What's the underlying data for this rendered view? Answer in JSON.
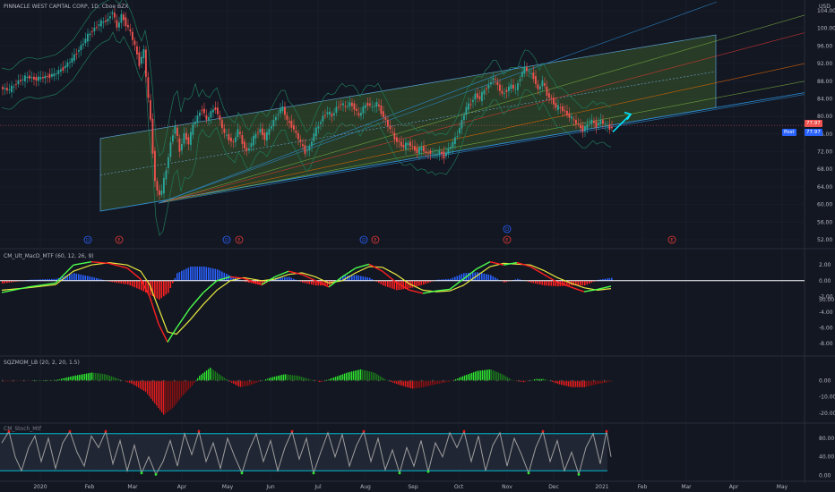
{
  "header": {
    "symbol_title": "PINNACLE WEST CAPITAL CORP, 1D, Cboe BZX",
    "currency": "USD",
    "price_tag": "77.97",
    "post_label": "Post",
    "post_tag": "77.97"
  },
  "colors": {
    "background": "#131722",
    "up_candle": "#26a69a",
    "down_candle": "#ef5350",
    "channel_fill": "#3b5a2a",
    "channel_line": "#2d8fd6",
    "macd_fast": "#4cff4c",
    "macd_slow": "#e8e840",
    "hist_pos": "#2962ff",
    "hist_neg": "#ff2020",
    "sqz_pos": "#2ee62e",
    "sqz_neg": "#e41c1c",
    "stoch_line": "#9e9e9e",
    "stoch_band": "#00bcd4",
    "arrow": "#00e5ff"
  },
  "panes": {
    "macd": {
      "title": "CM_Ult_MacD_MTF (60, 12, 26, 9)",
      "ticks": [
        "2.00",
        "0.00",
        "-2.00",
        "-4.00",
        "-6.00",
        "-8.00"
      ]
    },
    "sqz": {
      "title": "SQZMOM_LB (20, 2, 20, 1.5)",
      "ticks": [
        "50.00",
        "0.00",
        "-10.00",
        "-20.00"
      ]
    },
    "stoch": {
      "title": "CM_Stoch_Mtf",
      "ticks": [
        "80.00",
        "40.00",
        "0.00"
      ]
    }
  },
  "events": [
    {
      "label": "D",
      "type": "dividend"
    },
    {
      "label": "E",
      "type": "earnings"
    },
    {
      "label": "D",
      "type": "dividend"
    },
    {
      "label": "E",
      "type": "earnings"
    },
    {
      "label": "D",
      "type": "dividend"
    },
    {
      "label": "E",
      "type": "earnings"
    },
    {
      "label": "D",
      "type": "dividend"
    },
    {
      "label": "E",
      "type": "earnings"
    },
    {
      "label": "E",
      "type": "earnings"
    }
  ],
  "chart_data": {
    "type": "candlestick",
    "ylim": [
      50,
      106
    ],
    "y_ticks": [
      "104.00",
      "100.00",
      "96.00",
      "92.00",
      "88.00",
      "84.00",
      "80.00",
      "76.00",
      "72.00",
      "68.00",
      "64.00",
      "60.00",
      "56.00",
      "52.00"
    ],
    "x_ticks": [
      "2020",
      "Feb",
      "Mar",
      "Apr",
      "May",
      "Jun",
      "Jul",
      "Aug",
      "Sep",
      "Oct",
      "Nov",
      "Dec",
      "2021",
      "Feb",
      "Mar",
      "Apr",
      "May"
    ],
    "price_path": [
      [
        0,
        86.5
      ],
      [
        10,
        86
      ],
      [
        20,
        88
      ],
      [
        30,
        89
      ],
      [
        40,
        88.5
      ],
      [
        50,
        89
      ],
      [
        60,
        89.5
      ],
      [
        70,
        91
      ],
      [
        80,
        93
      ],
      [
        90,
        96
      ],
      [
        100,
        99
      ],
      [
        110,
        101
      ],
      [
        120,
        102
      ],
      [
        125,
        104
      ],
      [
        130,
        100
      ],
      [
        135,
        103
      ],
      [
        140,
        101
      ],
      [
        145,
        99
      ],
      [
        150,
        96
      ],
      [
        155,
        92
      ],
      [
        160,
        95
      ],
      [
        163,
        88
      ],
      [
        168,
        78
      ],
      [
        172,
        66
      ],
      [
        176,
        62
      ],
      [
        180,
        63
      ],
      [
        185,
        68
      ],
      [
        190,
        74
      ],
      [
        195,
        78
      ],
      [
        200,
        72
      ],
      [
        205,
        76
      ],
      [
        210,
        74
      ],
      [
        215,
        78
      ],
      [
        220,
        80
      ],
      [
        225,
        82
      ],
      [
        230,
        79
      ],
      [
        235,
        81
      ],
      [
        240,
        82
      ],
      [
        245,
        79
      ],
      [
        250,
        76
      ],
      [
        255,
        75
      ],
      [
        260,
        74
      ],
      [
        265,
        77
      ],
      [
        270,
        74
      ],
      [
        275,
        72
      ],
      [
        280,
        74
      ],
      [
        285,
        76
      ],
      [
        290,
        77
      ],
      [
        295,
        75
      ],
      [
        300,
        77
      ],
      [
        305,
        79
      ],
      [
        310,
        81
      ],
      [
        315,
        82
      ],
      [
        320,
        79
      ],
      [
        325,
        78
      ],
      [
        330,
        76
      ],
      [
        335,
        74
      ],
      [
        340,
        72
      ],
      [
        345,
        73
      ],
      [
        350,
        76
      ],
      [
        355,
        78
      ],
      [
        360,
        80
      ],
      [
        365,
        81
      ],
      [
        370,
        80
      ],
      [
        375,
        82
      ],
      [
        380,
        83
      ],
      [
        385,
        82
      ],
      [
        390,
        83
      ],
      [
        395,
        82
      ],
      [
        400,
        80
      ],
      [
        405,
        82
      ],
      [
        410,
        83
      ],
      [
        415,
        82
      ],
      [
        420,
        83
      ],
      [
        425,
        81
      ],
      [
        430,
        79
      ],
      [
        435,
        77
      ],
      [
        440,
        75
      ],
      [
        445,
        74
      ],
      [
        450,
        73
      ],
      [
        455,
        74
      ],
      [
        460,
        73
      ],
      [
        465,
        72
      ],
      [
        470,
        73
      ],
      [
        475,
        71.5
      ],
      [
        480,
        72
      ],
      [
        485,
        71
      ],
      [
        490,
        72
      ],
      [
        495,
        71
      ],
      [
        500,
        72.5
      ],
      [
        505,
        74
      ],
      [
        510,
        76
      ],
      [
        515,
        79
      ],
      [
        520,
        82
      ],
      [
        525,
        83
      ],
      [
        530,
        85
      ],
      [
        535,
        84
      ],
      [
        540,
        86
      ],
      [
        545,
        87
      ],
      [
        550,
        89
      ],
      [
        555,
        87
      ],
      [
        560,
        85
      ],
      [
        565,
        86
      ],
      [
        570,
        87
      ],
      [
        575,
        86
      ],
      [
        580,
        89
      ],
      [
        585,
        91
      ],
      [
        590,
        90
      ],
      [
        595,
        89
      ],
      [
        600,
        86
      ],
      [
        605,
        88
      ],
      [
        610,
        85
      ],
      [
        615,
        84
      ],
      [
        620,
        82
      ],
      [
        625,
        82
      ],
      [
        630,
        81
      ],
      [
        635,
        80
      ],
      [
        640,
        79
      ],
      [
        645,
        78
      ],
      [
        650,
        77
      ],
      [
        655,
        78
      ],
      [
        660,
        79
      ],
      [
        665,
        78
      ],
      [
        670,
        79
      ],
      [
        675,
        78
      ],
      [
        680,
        77.5
      ]
    ],
    "channel": {
      "lower": [
        [
          110,
          58.5
        ],
        [
          797,
          82
        ]
      ],
      "upper": [
        [
          110,
          75
        ],
        [
          797,
          98.5
        ]
      ],
      "mid": [
        [
          110,
          66.7
        ],
        [
          797,
          90.2
        ]
      ]
    },
    "arrow": {
      "from": [
        682,
        76.5
      ],
      "to": [
        702,
        80.5
      ]
    },
    "macd": {
      "ylim": [
        -9,
        3.5
      ],
      "fast": [
        [
          0,
          -1.5
        ],
        [
          30,
          -0.8
        ],
        [
          60,
          -0.3
        ],
        [
          80,
          2
        ],
        [
          100,
          2.4
        ],
        [
          120,
          2.2
        ],
        [
          140,
          1.6
        ],
        [
          155,
          0.2
        ],
        [
          165,
          -2
        ],
        [
          175,
          -5.5
        ],
        [
          185,
          -7.8
        ],
        [
          195,
          -6
        ],
        [
          210,
          -3.5
        ],
        [
          225,
          -1.5
        ],
        [
          240,
          0
        ],
        [
          255,
          0.5
        ],
        [
          270,
          0.3
        ],
        [
          290,
          -0.5
        ],
        [
          305,
          0.5
        ],
        [
          320,
          1.2
        ],
        [
          335,
          0.8
        ],
        [
          350,
          0
        ],
        [
          365,
          -0.8
        ],
        [
          380,
          0.5
        ],
        [
          395,
          1.6
        ],
        [
          410,
          2.1
        ],
        [
          425,
          1.2
        ],
        [
          440,
          -0.2
        ],
        [
          455,
          -1.2
        ],
        [
          470,
          -1.6
        ],
        [
          485,
          -1.3
        ],
        [
          500,
          -1.1
        ],
        [
          515,
          0.2
        ],
        [
          530,
          1.5
        ],
        [
          545,
          2.4
        ],
        [
          560,
          2.0
        ],
        [
          575,
          2.3
        ],
        [
          590,
          1.8
        ],
        [
          605,
          0.8
        ],
        [
          620,
          -0.2
        ],
        [
          635,
          -0.8
        ],
        [
          650,
          -1.4
        ],
        [
          665,
          -1.1
        ],
        [
          680,
          -0.7
        ]
      ],
      "slow": [
        [
          0,
          -1.2
        ],
        [
          30,
          -0.9
        ],
        [
          60,
          -0.5
        ],
        [
          80,
          1.2
        ],
        [
          100,
          2.0
        ],
        [
          120,
          2.3
        ],
        [
          140,
          2.0
        ],
        [
          155,
          1.2
        ],
        [
          165,
          -0.5
        ],
        [
          175,
          -3.5
        ],
        [
          185,
          -6.5
        ],
        [
          195,
          -6.8
        ],
        [
          210,
          -5
        ],
        [
          225,
          -3
        ],
        [
          240,
          -1.2
        ],
        [
          255,
          0
        ],
        [
          270,
          0.4
        ],
        [
          290,
          0
        ],
        [
          305,
          0.2
        ],
        [
          320,
          0.8
        ],
        [
          335,
          1
        ],
        [
          350,
          0.5
        ],
        [
          365,
          -0.3
        ],
        [
          380,
          0
        ],
        [
          395,
          1
        ],
        [
          410,
          1.8
        ],
        [
          425,
          1.7
        ],
        [
          440,
          0.8
        ],
        [
          455,
          -0.4
        ],
        [
          470,
          -1.2
        ],
        [
          485,
          -1.4
        ],
        [
          500,
          -1.3
        ],
        [
          515,
          -0.6
        ],
        [
          530,
          0.6
        ],
        [
          545,
          1.8
        ],
        [
          560,
          2.2
        ],
        [
          575,
          2.1
        ],
        [
          590,
          2.0
        ],
        [
          605,
          1.3
        ],
        [
          620,
          0.4
        ],
        [
          635,
          -0.3
        ],
        [
          650,
          -0.9
        ],
        [
          665,
          -1.2
        ],
        [
          680,
          -1.0
        ]
      ]
    },
    "squeeze": {
      "ylim": [
        -24,
        13
      ],
      "values": [
        [
          0,
          -0.5
        ],
        [
          20,
          -0.3
        ],
        [
          40,
          0.2
        ],
        [
          60,
          0.4
        ],
        [
          80,
          3
        ],
        [
          100,
          5
        ],
        [
          115,
          4
        ],
        [
          130,
          1
        ],
        [
          145,
          -2
        ],
        [
          160,
          -7
        ],
        [
          170,
          -14
        ],
        [
          180,
          -21
        ],
        [
          190,
          -17
        ],
        [
          200,
          -10
        ],
        [
          212,
          -3
        ],
        [
          220,
          3
        ],
        [
          232,
          8
        ],
        [
          242,
          4
        ],
        [
          255,
          -1
        ],
        [
          265,
          -4
        ],
        [
          275,
          -3
        ],
        [
          285,
          -1
        ],
        [
          300,
          2
        ],
        [
          315,
          4
        ],
        [
          330,
          3
        ],
        [
          345,
          0.5
        ],
        [
          355,
          -1
        ],
        [
          370,
          2
        ],
        [
          385,
          5
        ],
        [
          400,
          7
        ],
        [
          415,
          5
        ],
        [
          430,
          0
        ],
        [
          445,
          -3
        ],
        [
          458,
          -5
        ],
        [
          470,
          -4
        ],
        [
          485,
          -2
        ],
        [
          500,
          -0.5
        ],
        [
          515,
          3
        ],
        [
          530,
          6
        ],
        [
          545,
          7
        ],
        [
          558,
          4
        ],
        [
          570,
          0
        ],
        [
          582,
          -1
        ],
        [
          595,
          1
        ],
        [
          605,
          1
        ],
        [
          620,
          -2
        ],
        [
          635,
          -4
        ],
        [
          650,
          -4
        ],
        [
          665,
          -2
        ],
        [
          680,
          -0.5
        ]
      ]
    },
    "stoch": {
      "ylim": [
        -5,
        105
      ],
      "upper_band": 90,
      "lower_band": 10,
      "values": [
        [
          0,
          70
        ],
        [
          8,
          95
        ],
        [
          15,
          40
        ],
        [
          22,
          10
        ],
        [
          30,
          60
        ],
        [
          37,
          85
        ],
        [
          44,
          30
        ],
        [
          52,
          80
        ],
        [
          60,
          15
        ],
        [
          68,
          70
        ],
        [
          76,
          95
        ],
        [
          84,
          50
        ],
        [
          92,
          20
        ],
        [
          100,
          85
        ],
        [
          108,
          60
        ],
        [
          116,
          95
        ],
        [
          124,
          25
        ],
        [
          132,
          75
        ],
        [
          140,
          10
        ],
        [
          148,
          65
        ],
        [
          156,
          5
        ],
        [
          164,
          40
        ],
        [
          172,
          2
        ],
        [
          180,
          30
        ],
        [
          188,
          75
        ],
        [
          196,
          20
        ],
        [
          204,
          90
        ],
        [
          212,
          45
        ],
        [
          220,
          95
        ],
        [
          228,
          30
        ],
        [
          236,
          70
        ],
        [
          244,
          15
        ],
        [
          252,
          80
        ],
        [
          260,
          40
        ],
        [
          268,
          5
        ],
        [
          276,
          55
        ],
        [
          284,
          90
        ],
        [
          292,
          30
        ],
        [
          300,
          75
        ],
        [
          308,
          10
        ],
        [
          316,
          60
        ],
        [
          324,
          95
        ],
        [
          332,
          35
        ],
        [
          340,
          80
        ],
        [
          348,
          5
        ],
        [
          356,
          50
        ],
        [
          364,
          92
        ],
        [
          372,
          40
        ],
        [
          380,
          88
        ],
        [
          388,
          20
        ],
        [
          396,
          65
        ],
        [
          404,
          95
        ],
        [
          412,
          30
        ],
        [
          420,
          80
        ],
        [
          428,
          12
        ],
        [
          436,
          55
        ],
        [
          444,
          5
        ],
        [
          452,
          60
        ],
        [
          460,
          20
        ],
        [
          468,
          75
        ],
        [
          476,
          8
        ],
        [
          484,
          70
        ],
        [
          492,
          40
        ],
        [
          500,
          92
        ],
        [
          508,
          60
        ],
        [
          516,
          95
        ],
        [
          524,
          30
        ],
        [
          532,
          85
        ],
        [
          540,
          10
        ],
        [
          548,
          65
        ],
        [
          556,
          92
        ],
        [
          564,
          20
        ],
        [
          572,
          80
        ],
        [
          580,
          45
        ],
        [
          588,
          5
        ],
        [
          596,
          60
        ],
        [
          604,
          95
        ],
        [
          612,
          30
        ],
        [
          620,
          75
        ],
        [
          628,
          10
        ],
        [
          636,
          50
        ],
        [
          644,
          2
        ],
        [
          652,
          60
        ],
        [
          660,
          90
        ],
        [
          668,
          25
        ],
        [
          675,
          95
        ],
        [
          680,
          40
        ]
      ]
    }
  }
}
